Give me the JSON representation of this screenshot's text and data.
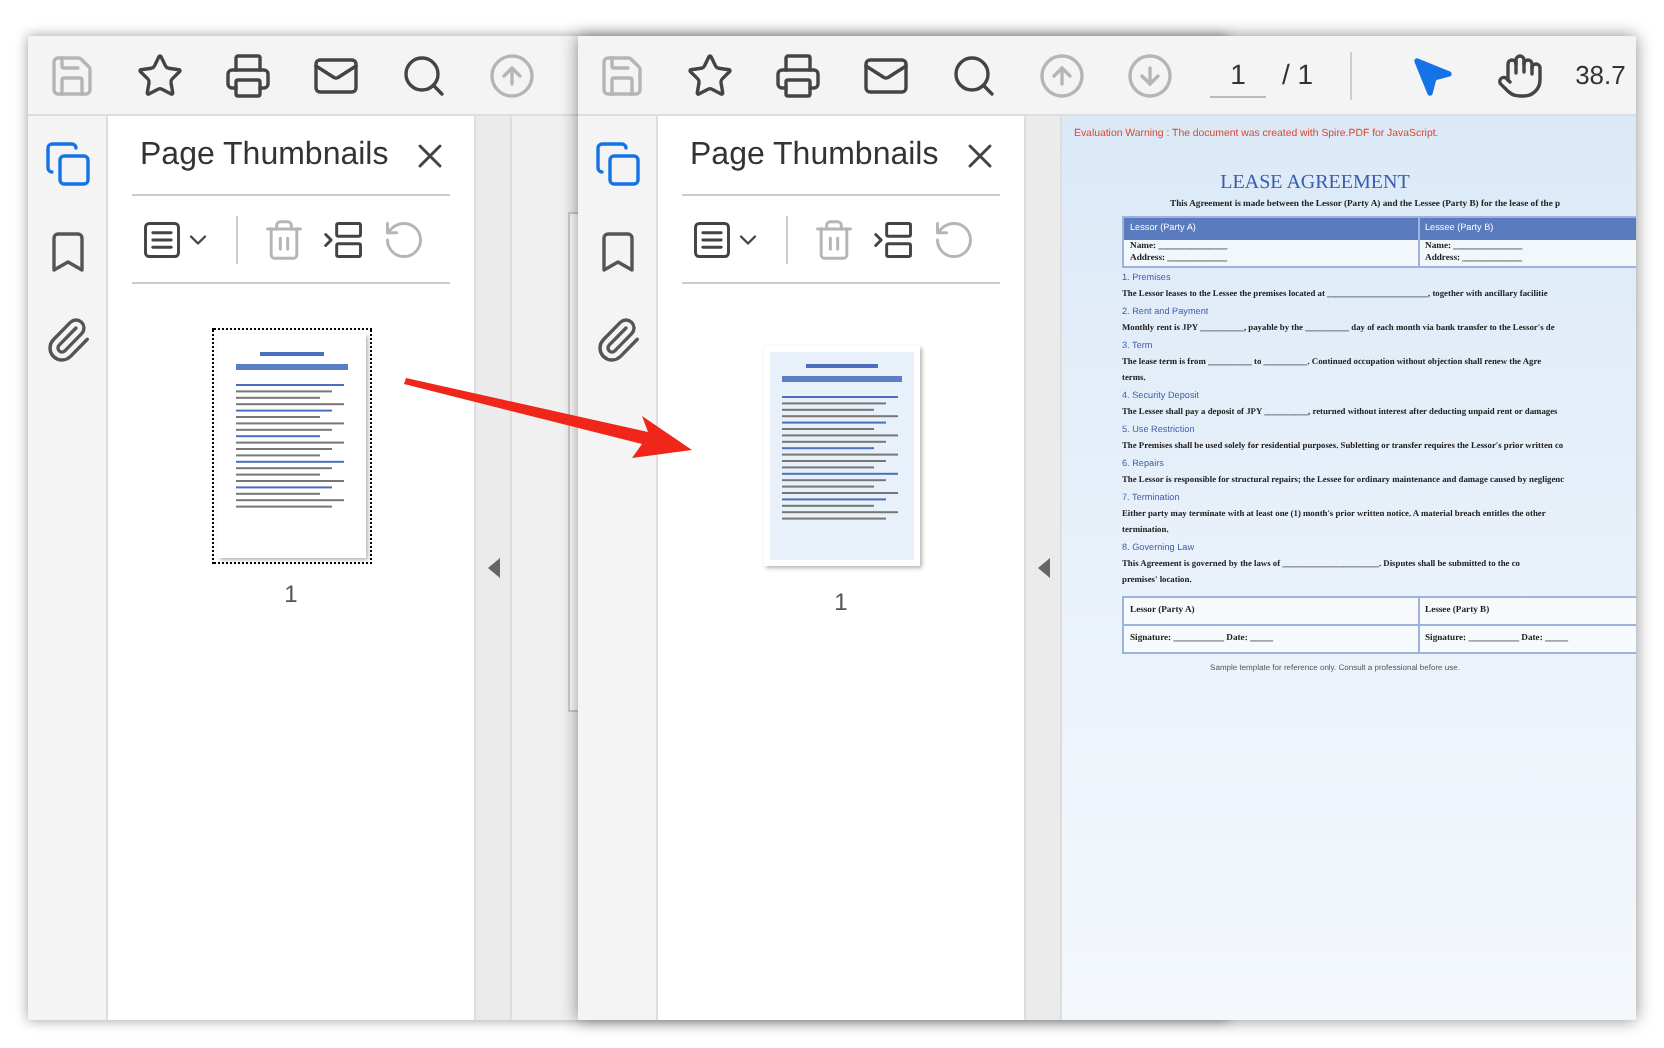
{
  "back_window": {
    "tools": [
      {
        "kind": "save",
        "disabled": true
      },
      {
        "kind": "star",
        "disabled": false
      },
      {
        "kind": "print",
        "disabled": false
      },
      {
        "kind": "mail",
        "disabled": false
      },
      {
        "kind": "zoom",
        "disabled": false
      },
      {
        "kind": "up",
        "disabled": true
      }
    ],
    "rail": [
      {
        "kind": "pages",
        "selected": true
      },
      {
        "kind": "bookmarks",
        "selected": false
      },
      {
        "kind": "attachments",
        "selected": false
      }
    ],
    "panel": {
      "title": "Page Thumbnails"
    },
    "thumbnails": [
      {
        "label": "1",
        "selected": true
      }
    ]
  },
  "front_window": {
    "tools": [
      {
        "kind": "save",
        "disabled": true
      },
      {
        "kind": "star",
        "disabled": false
      },
      {
        "kind": "print",
        "disabled": false
      },
      {
        "kind": "mail",
        "disabled": false
      },
      {
        "kind": "zoom",
        "disabled": false
      },
      {
        "kind": "up",
        "disabled": true
      },
      {
        "kind": "down",
        "disabled": true
      }
    ],
    "page_number": "1",
    "page_count": "/ 1",
    "modes": [
      {
        "kind": "select",
        "selected": true
      },
      {
        "kind": "hand",
        "selected": false
      }
    ],
    "zoom": "38.7",
    "rail": [
      {
        "kind": "pages",
        "selected": true
      },
      {
        "kind": "bookmarks",
        "selected": false
      },
      {
        "kind": "attachments",
        "selected": false
      }
    ],
    "panel": {
      "title": "Page Thumbnails"
    },
    "thumbnails": [
      {
        "label": "1",
        "selected": false
      }
    ],
    "document": {
      "warning": "Evaluation Warning : The document was created with Spire.PDF for JavaScript.",
      "title": "LEASE AGREEMENT",
      "intro": "This Agreement is made between the Lessor (Party A) and the Lessee (Party B) for the lease of the p",
      "parties": [
        {
          "heading": "Lessor (Party A)",
          "fields": [
            "Name: _______________",
            "Address: _____________"
          ]
        },
        {
          "heading": "Lessee (Party B)",
          "fields": [
            "Name: _______________",
            "Address: _____________"
          ]
        }
      ],
      "sections": [
        {
          "heading": "1. Premises",
          "lines": [
            "The Lessor leases to the Lessee the premises located at _______________________, together with ancillary facilitie"
          ]
        },
        {
          "heading": "2. Rent and Payment",
          "lines": [
            "Monthly rent is JPY __________, payable by the __________ day of each month via bank transfer to the Lessor's de"
          ]
        },
        {
          "heading": "3. Term",
          "lines": [
            "The lease term is from __________ to __________. Continued occupation without objection shall renew the Agre",
            "terms."
          ]
        },
        {
          "heading": "4. Security Deposit",
          "lines": [
            "The Lessee shall pay a deposit of JPY __________, returned without interest after deducting unpaid rent or damages"
          ]
        },
        {
          "heading": "5. Use Restriction",
          "lines": [
            "The Premises shall be used solely for residential purposes. Subletting or transfer requires the Lessor's prior written co"
          ]
        },
        {
          "heading": "6. Repairs",
          "lines": [
            "The Lessor is responsible for structural repairs; the Lessee for ordinary maintenance and damage caused by negligenc"
          ]
        },
        {
          "heading": "7. Termination",
          "lines": [
            "Either party may terminate with at least one (1) month's prior written notice. A material breach entitles the other",
            "termination."
          ]
        },
        {
          "heading": "8. Governing Law",
          "lines": [
            "This Agreement is governed by the laws of ______________________. Disputes shall be submitted to the co",
            "premises' location."
          ]
        }
      ],
      "signatures": [
        {
          "party": "Lessor (Party A)",
          "line": "Signature: ___________ Date: _____"
        },
        {
          "party": "Lessee (Party B)",
          "line": "Signature: ___________ Date: _____"
        }
      ],
      "footer": "Sample template for reference only. Consult a professional before use."
    }
  }
}
